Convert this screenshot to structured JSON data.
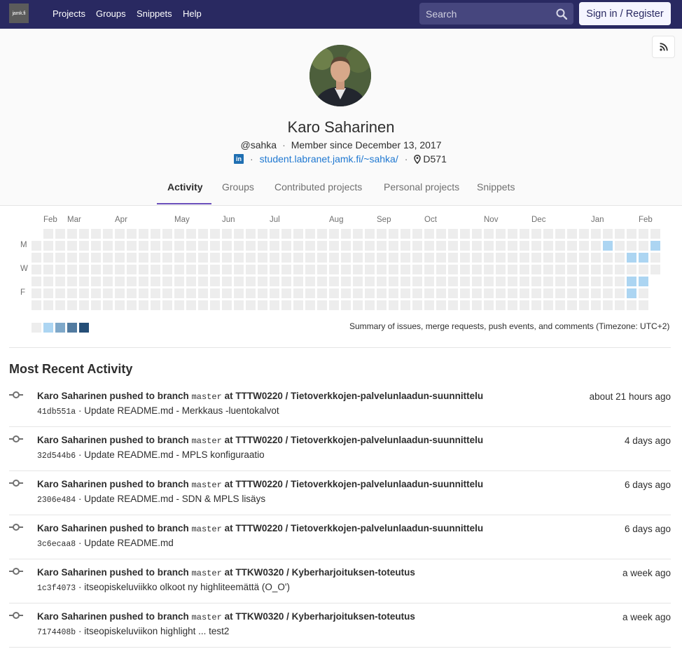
{
  "nav": {
    "logo": "jamk.fi",
    "links": [
      "Projects",
      "Groups",
      "Snippets",
      "Help"
    ],
    "search_placeholder": "Search",
    "signin": "Sign in / Register"
  },
  "profile": {
    "name": "Karo Saharinen",
    "username": "@sahka",
    "member_since": "Member since December 13, 2017",
    "website": "student.labranet.jamk.fi/~sahka/",
    "location": "D571",
    "linkedin_label": "in"
  },
  "tabs": [
    "Activity",
    "Groups",
    "Contributed projects",
    "Personal projects",
    "Snippets"
  ],
  "active_tab": "Activity",
  "calendar": {
    "months": [
      "Feb",
      "Mar",
      "Apr",
      "May",
      "Jun",
      "Jul",
      "Aug",
      "Sep",
      "Oct",
      "Nov",
      "Dec",
      "Jan",
      "Feb"
    ],
    "day_labels": [
      "M",
      "W",
      "F"
    ],
    "summary": "Summary of issues, merge requests, push events, and comments (Timezone: UTC+2)",
    "legend_colors": [
      "#ededed",
      "#acd5f2",
      "#7fa8c9",
      "#527ba0",
      "#254e77"
    ],
    "active_cells": [
      {
        "week": 48,
        "day": 1,
        "level": 1
      },
      {
        "week": 52,
        "day": 1,
        "level": 1
      },
      {
        "week": 50,
        "day": 2,
        "level": 1
      },
      {
        "week": 51,
        "day": 2,
        "level": 1
      },
      {
        "week": 50,
        "day": 4,
        "level": 1
      },
      {
        "week": 51,
        "day": 4,
        "level": 1
      },
      {
        "week": 50,
        "day": 5,
        "level": 1
      }
    ]
  },
  "activity": {
    "title": "Most Recent Activity",
    "events": [
      {
        "author": "Karo Saharinen",
        "action": "pushed to branch",
        "branch": "master",
        "at": "at",
        "project": "TTTW0220 / Tietoverkkojen-palvelunlaadun-suunnittelu",
        "time": "about 21 hours ago",
        "sha": "41db551a",
        "sep": "·",
        "message": "Update README.md - Merkkaus -luentokalvot"
      },
      {
        "author": "Karo Saharinen",
        "action": "pushed to branch",
        "branch": "master",
        "at": "at",
        "project": "TTTW0220 / Tietoverkkojen-palvelunlaadun-suunnittelu",
        "time": "4 days ago",
        "sha": "32d544b6",
        "sep": "·",
        "message": "Update README.md - MPLS konfiguraatio"
      },
      {
        "author": "Karo Saharinen",
        "action": "pushed to branch",
        "branch": "master",
        "at": "at",
        "project": "TTTW0220 / Tietoverkkojen-palvelunlaadun-suunnittelu",
        "time": "6 days ago",
        "sha": "2306e484",
        "sep": "·",
        "message": "Update README.md - SDN & MPLS lisäys"
      },
      {
        "author": "Karo Saharinen",
        "action": "pushed to branch",
        "branch": "master",
        "at": "at",
        "project": "TTTW0220 / Tietoverkkojen-palvelunlaadun-suunnittelu",
        "time": "6 days ago",
        "sha": "3c6ecaa8",
        "sep": "·",
        "message": "Update README.md"
      },
      {
        "author": "Karo Saharinen",
        "action": "pushed to branch",
        "branch": "master",
        "at": "at",
        "project": "TTKW0320 / Kyberharjoituksen-toteutus",
        "time": "a week ago",
        "sha": "1c3f4073",
        "sep": "·",
        "message": "itseopiskeluviikko olkoot ny highliteemättä (O_O')"
      },
      {
        "author": "Karo Saharinen",
        "action": "pushed to branch",
        "branch": "master",
        "at": "at",
        "project": "TTKW0320 / Kyberharjoituksen-toteutus",
        "time": "a week ago",
        "sha": "7174408b",
        "sep": "·",
        "message": "itseopiskeluviikon highlight ... test2"
      }
    ]
  }
}
